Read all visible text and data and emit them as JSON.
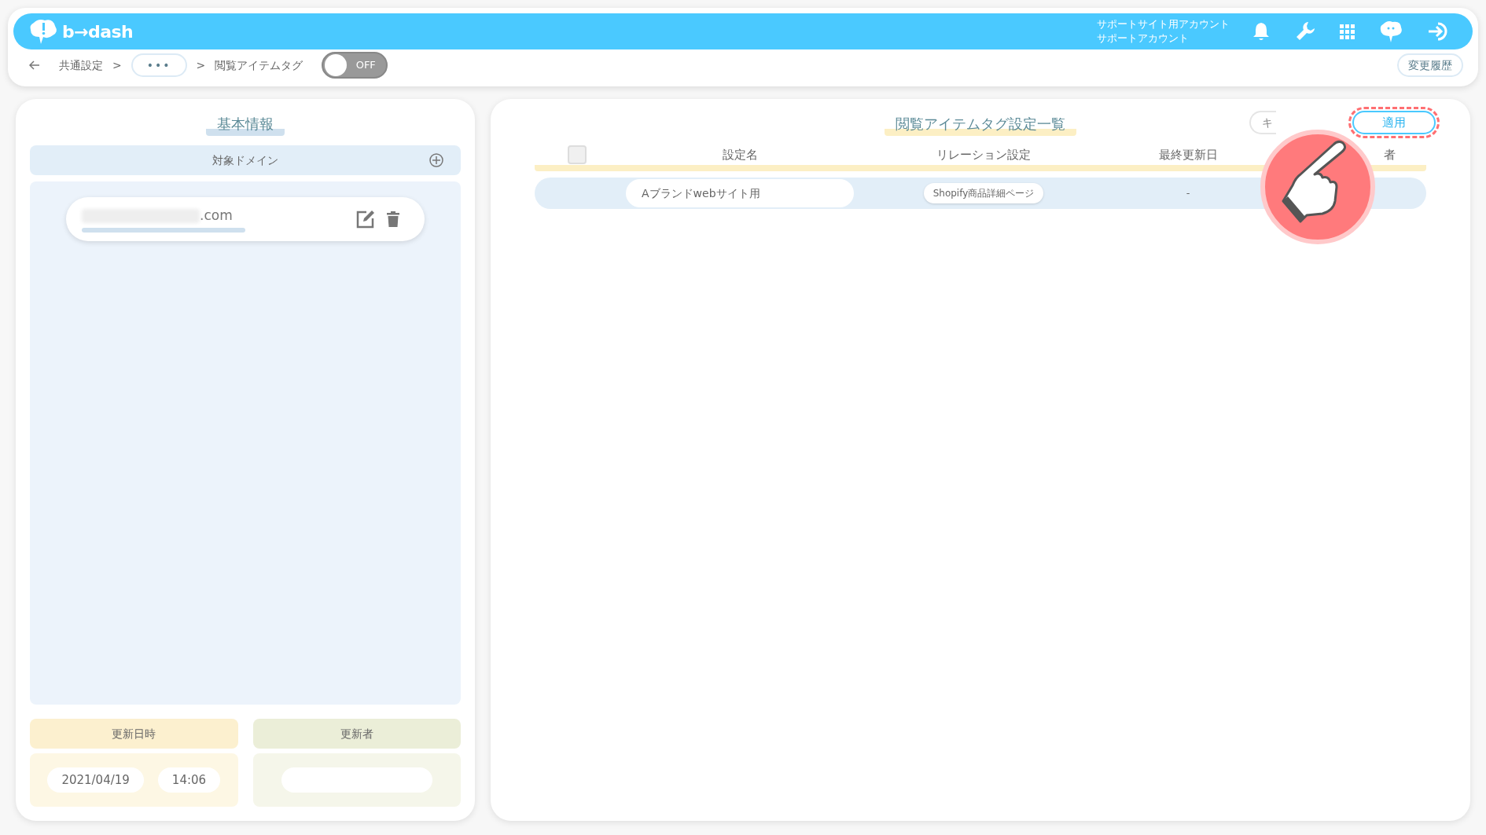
{
  "header": {
    "logo": "b→dash",
    "account_lines": [
      "サポートサイト用アカウント",
      "サポートアカウント"
    ]
  },
  "breadcrumb": {
    "items": [
      "共通設定",
      "•••",
      "閲覧アイテムタグ"
    ],
    "separator": ">",
    "toggle": {
      "label": "OFF",
      "on": false
    }
  },
  "history_button": "変更履歴",
  "basic_info": {
    "title": "基本情報",
    "domain_header": "対象ドメイン",
    "domains": [
      {
        "text": ".com"
      }
    ],
    "updated_at": {
      "label": "更新日時",
      "date": "2021/04/19",
      "time": "14:06"
    },
    "updated_by": {
      "label": "更新者"
    }
  },
  "tag_list": {
    "title": "閲覧アイテムタグ設定一覧",
    "buttons": [
      {
        "label": "キ",
        "kind": "cancel"
      },
      {
        "label": "適用",
        "kind": "apply"
      }
    ],
    "columns": [
      "設定名",
      "リレーション設定",
      "最終更新日",
      "者"
    ],
    "select_all": {
      "checked": false
    },
    "rows": [
      {
        "name": "Aブランドwebサイト用",
        "relation": "Shopify商品詳細ページ",
        "updated": "-"
      }
    ]
  }
}
